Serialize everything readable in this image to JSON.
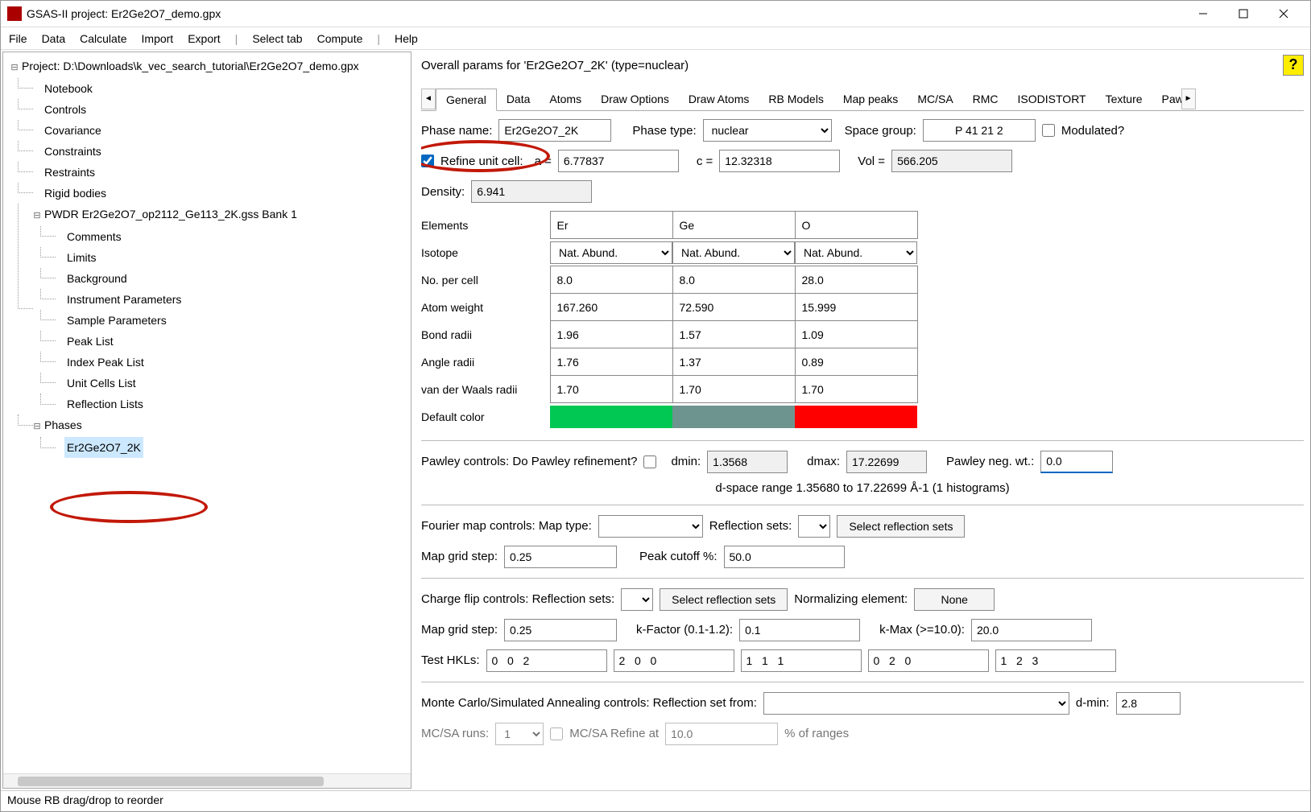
{
  "title": "GSAS-II project: Er2Ge2O7_demo.gpx",
  "menu": {
    "file": "File",
    "data": "Data",
    "calculate": "Calculate",
    "import": "Import",
    "export": "Export",
    "select_tab": "Select tab",
    "compute": "Compute",
    "help": "Help"
  },
  "tree": {
    "project": "Project: D:\\Downloads\\k_vec_search_tutorial\\Er2Ge2O7_demo.gpx",
    "notebook": "Notebook",
    "controls": "Controls",
    "covariance": "Covariance",
    "constraints": "Constraints",
    "restraints": "Restraints",
    "rigid": "Rigid bodies",
    "pwdr": "PWDR Er2Ge2O7_op2112_Ge113_2K.gss Bank 1",
    "comments": "Comments",
    "limits": "Limits",
    "background": "Background",
    "inst": "Instrument Parameters",
    "sample": "Sample Parameters",
    "peak": "Peak List",
    "index_peak": "Index Peak List",
    "unit_cells": "Unit Cells List",
    "refl": "Reflection Lists",
    "phases": "Phases",
    "phase1": "Er2Ge2O7_2K"
  },
  "header": "Overall params for 'Er2Ge2O7_2K' (type=nuclear)",
  "tabs": [
    "General",
    "Data",
    "Atoms",
    "Draw Options",
    "Draw Atoms",
    "RB Models",
    "Map peaks",
    "MC/SA",
    "RMC",
    "ISODISTORT",
    "Texture",
    "Pawley"
  ],
  "general": {
    "phase_name_lbl": "Phase name:",
    "phase_name": "Er2Ge2O7_2K",
    "phase_type_lbl": "Phase type:",
    "phase_type": "nuclear",
    "space_group_lbl": "Space group:",
    "space_group": "P 41 21 2",
    "modulated": "Modulated?",
    "refine_cell": "Refine unit cell:",
    "a_lbl": "a =",
    "a": "6.77837",
    "c_lbl": "c =",
    "c": "12.32318",
    "vol_lbl": "Vol =",
    "vol": "566.205",
    "density_lbl": "Density:",
    "density": "6.941"
  },
  "elements": {
    "rows": [
      "Elements",
      "Isotope",
      "No. per cell",
      "Atom weight",
      "Bond radii",
      "Angle radii",
      "van der Waals radii",
      "Default color"
    ],
    "cols": [
      "Er",
      "Ge",
      "O"
    ],
    "isotope": [
      "Nat. Abund.",
      "Nat. Abund.",
      "Nat. Abund."
    ],
    "no_per_cell": [
      "8.0",
      "8.0",
      "28.0"
    ],
    "atom_wt": [
      "167.260",
      "72.590",
      "15.999"
    ],
    "bond": [
      "1.96",
      "1.57",
      "1.09"
    ],
    "angle": [
      "1.76",
      "1.37",
      "0.89"
    ],
    "vdw": [
      "1.70",
      "1.70",
      "1.70"
    ],
    "colors": [
      "#00c853",
      "#6e9490",
      "#ff0000"
    ]
  },
  "pawley": {
    "ctrl_lbl": "Pawley controls:  Do Pawley refinement?",
    "dmin_lbl": "dmin:",
    "dmin": "1.3568",
    "dmax_lbl": "dmax:",
    "dmax": "17.22699",
    "neg_lbl": "Pawley neg. wt.:",
    "neg": "0.0",
    "range": "d-space range 1.35680 to 17.22699 Å-1 (1 histograms)"
  },
  "fourier": {
    "ctrl": "Fourier map controls: Map type:",
    "refl_sets_lbl": "Reflection sets:",
    "select_refl": "Select reflection sets",
    "grid_lbl": "Map grid step:",
    "grid": "0.25",
    "peak_lbl": "Peak cutoff %:",
    "peak": "50.0"
  },
  "chargeflip": {
    "ctrl": "Charge flip controls: Reflection sets:",
    "select_refl": "Select reflection sets",
    "norm_lbl": "Normalizing element:",
    "norm": "None",
    "grid_lbl": "Map grid step:",
    "grid": "0.25",
    "kfact_lbl": "k-Factor (0.1-1.2):",
    "kfact": "0.1",
    "kmax_lbl": "k-Max (>=10.0):",
    "kmax": "20.0",
    "test_lbl": "Test HKLs:",
    "hkls": [
      "0   0   2",
      "2   0   0",
      "1   1   1",
      "0   2   0",
      "1   2   3"
    ]
  },
  "mcsa": {
    "ctrl": "Monte Carlo/Simulated Annealing controls: Reflection set from:",
    "dmin_lbl": "d-min:",
    "dmin": "2.8",
    "runs_lbl": "MC/SA runs:",
    "runs": "1",
    "refine_lbl": "MC/SA Refine at",
    "refine_val": "10.0",
    "suffix": "% of ranges"
  },
  "status": "Mouse RB drag/drop to reorder"
}
